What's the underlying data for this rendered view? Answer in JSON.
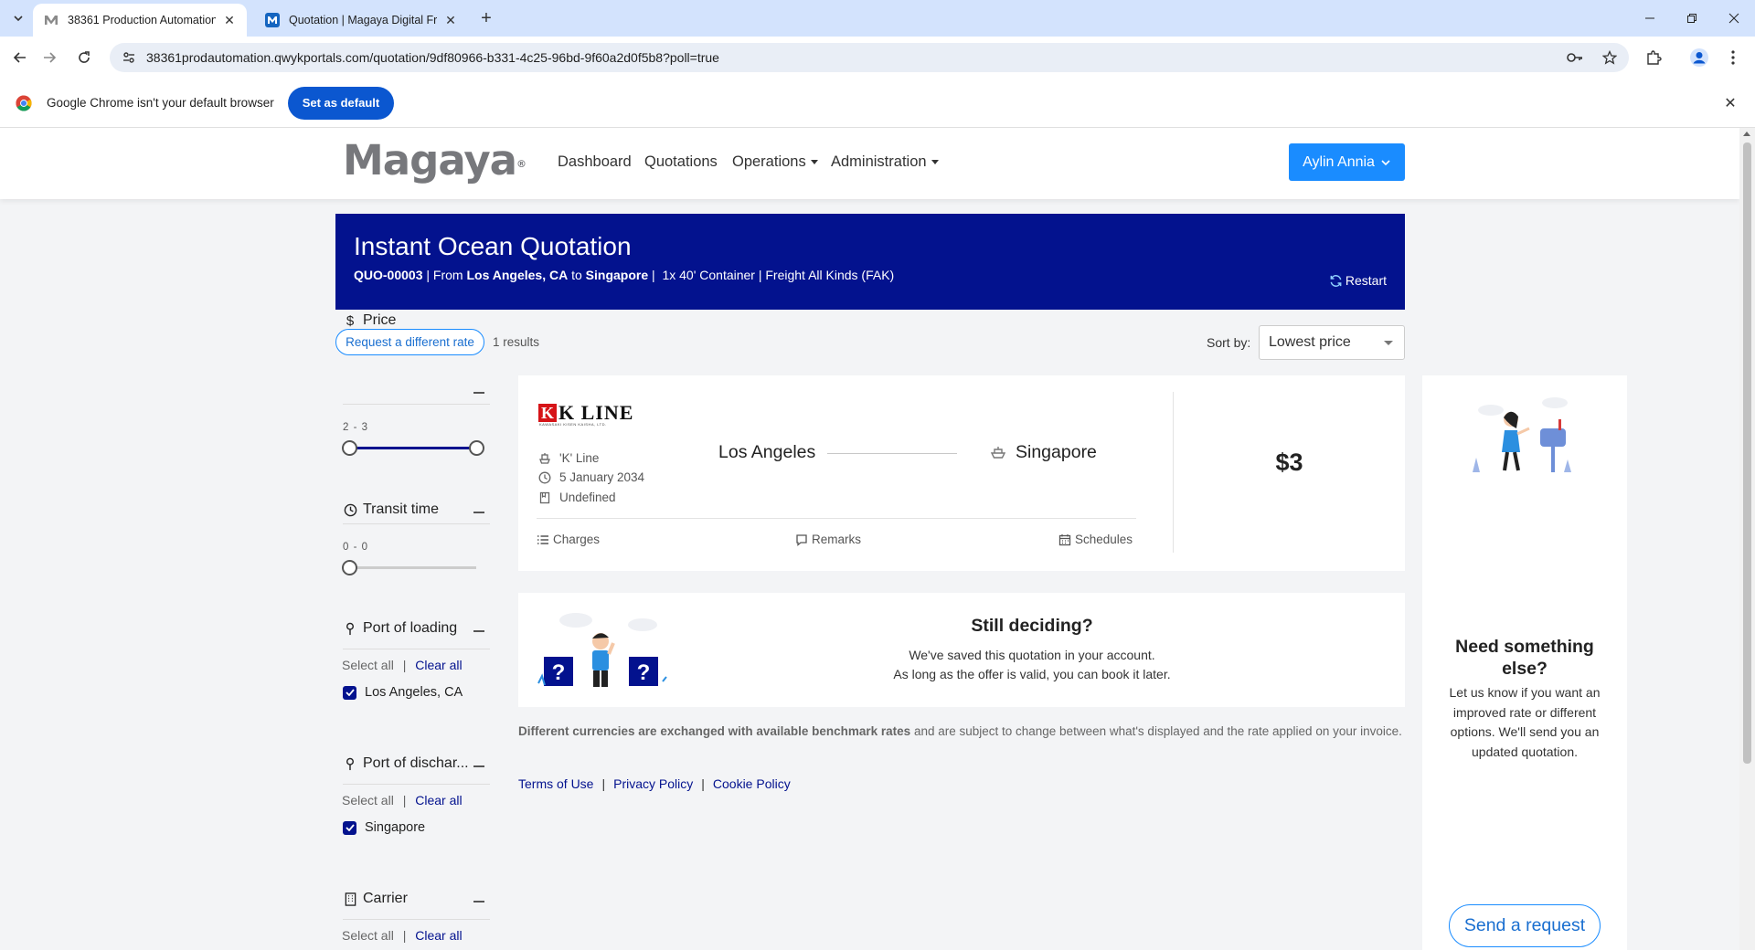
{
  "browser": {
    "tabs": [
      {
        "title": "38361 Production Automation",
        "active": true
      },
      {
        "title": "Quotation | Magaya Digital Fre",
        "active": false
      }
    ],
    "url": "38361prodautomation.qwykportals.com/quotation/9df80966-b331-4c25-96bd-9f60a2d0f5b8?poll=true",
    "infobar": {
      "text": "Google Chrome isn't your default browser",
      "button": "Set as default"
    }
  },
  "header": {
    "logo": "Magaya",
    "nav": {
      "dashboard": "Dashboard",
      "quotations": "Quotations",
      "operations": "Operations",
      "administration": "Administration"
    },
    "user": "Aylin Annia"
  },
  "banner": {
    "title": "Instant Ocean Quotation",
    "quote_id": "QUO-00003",
    "from_word": "| From",
    "origin": "Los Angeles, CA",
    "to_word": "to",
    "destination": "Singapore",
    "details": "|  1x 40' Container | Freight All Kinds (FAK)",
    "restart": "Restart"
  },
  "results_bar": {
    "request_button": "Request a different rate",
    "count": "1 results",
    "sort_label": "Sort by:",
    "sort_value": "Lowest price"
  },
  "filters": {
    "price": {
      "title": "Price",
      "range": "2 - 3",
      "fraction_low": 0,
      "fraction_high": 1
    },
    "transit": {
      "title": "Transit time",
      "range": "0 - 0"
    },
    "select_all": "Select all",
    "clear_all": "Clear all",
    "loading": {
      "title": "Port of loading",
      "option": "Los Angeles, CA"
    },
    "discharge": {
      "title": "Port of dischar...",
      "option": "Singapore"
    },
    "carrier": {
      "title": "Carrier"
    }
  },
  "result": {
    "carrier_logo": "K LINE",
    "carrier_logo_tagline": "KAWASAKI KISEN KAISHA, LTD.",
    "carrier_name": "'K' Line",
    "date": "5 January 2034",
    "service": "Undefined",
    "origin": "Los Angeles",
    "destination": "Singapore",
    "price": "$3",
    "links": {
      "charges": "Charges",
      "remarks": "Remarks",
      "schedules": "Schedules"
    }
  },
  "deciding": {
    "title": "Still deciding?",
    "line1": "We've saved this quotation in your account.",
    "line2": "As long as the offer is valid, you can book it later."
  },
  "disclaimer": {
    "bold": "Different currencies are exchanged with available benchmark rates",
    "rest": " and are subject to change between what's displayed and the rate applied on your invoice."
  },
  "footer": {
    "terms": "Terms of Use",
    "privacy": "Privacy Policy",
    "cookie": "Cookie Policy"
  },
  "side_panel": {
    "title": "Need something else?",
    "text": "Let us know if you want an improved rate or different options. We'll send you an updated quotation.",
    "button": "Send a request"
  },
  "colors": {
    "brand_navy": "#03128e",
    "accent_blue": "#1a8cff"
  }
}
